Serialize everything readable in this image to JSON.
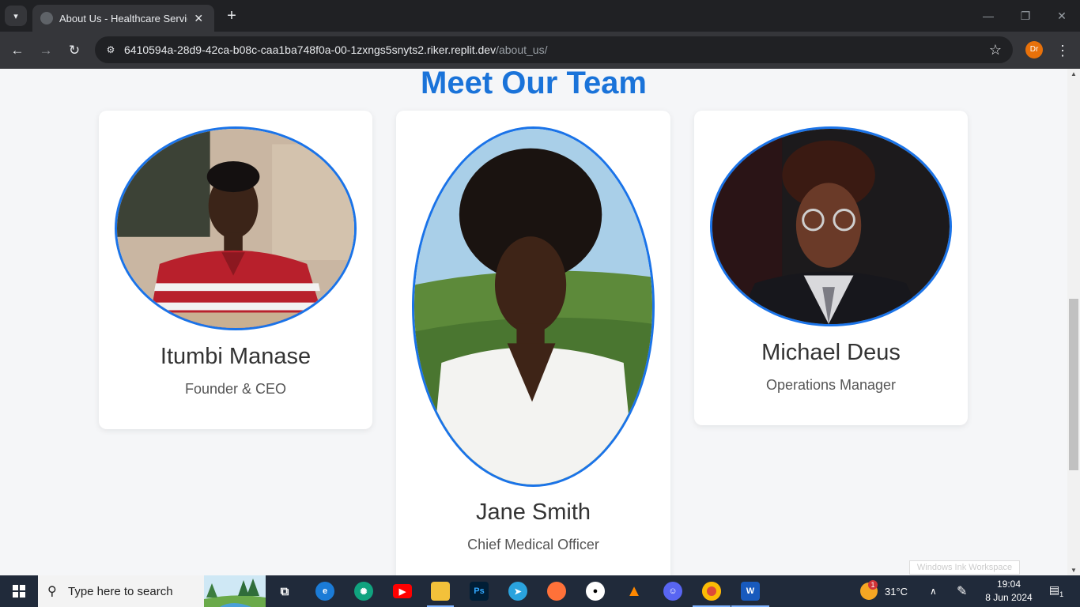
{
  "browser": {
    "tab_title": "About Us - Healthcare Service P",
    "url_host": "6410594a-28d9-42ca-b08c-caa1ba748f0a-00-1zxngs5snyts2.riker.replit.dev",
    "url_path": "/about_us/",
    "profile_initials": "Dr"
  },
  "page": {
    "title": "Meet Our Team",
    "members": [
      {
        "name": "Itumbi Manase",
        "role": "Founder & CEO"
      },
      {
        "name": "Jane Smith",
        "role": "Chief Medical Officer"
      },
      {
        "name": "Michael Deus",
        "role": "Operations Manager"
      }
    ],
    "accent_color": "#1a73e8"
  },
  "overlay": {
    "ink_workspace_tip": "Windows Ink Workspace"
  },
  "taskbar": {
    "search_placeholder": "Type here to search",
    "pinned": [
      "task-view-icon",
      "edge-icon",
      "chatgpt-icon",
      "youtube-icon",
      "file-explorer-icon",
      "photoshop-icon",
      "telegram-icon",
      "firefox-icon",
      "github-icon",
      "vlc-icon",
      "discord-icon",
      "chrome-icon",
      "word-icon"
    ],
    "weather": "31°C",
    "weather_badge": "1",
    "time": "19:04",
    "date": "8 Jun 2024",
    "notification_count": "1"
  }
}
